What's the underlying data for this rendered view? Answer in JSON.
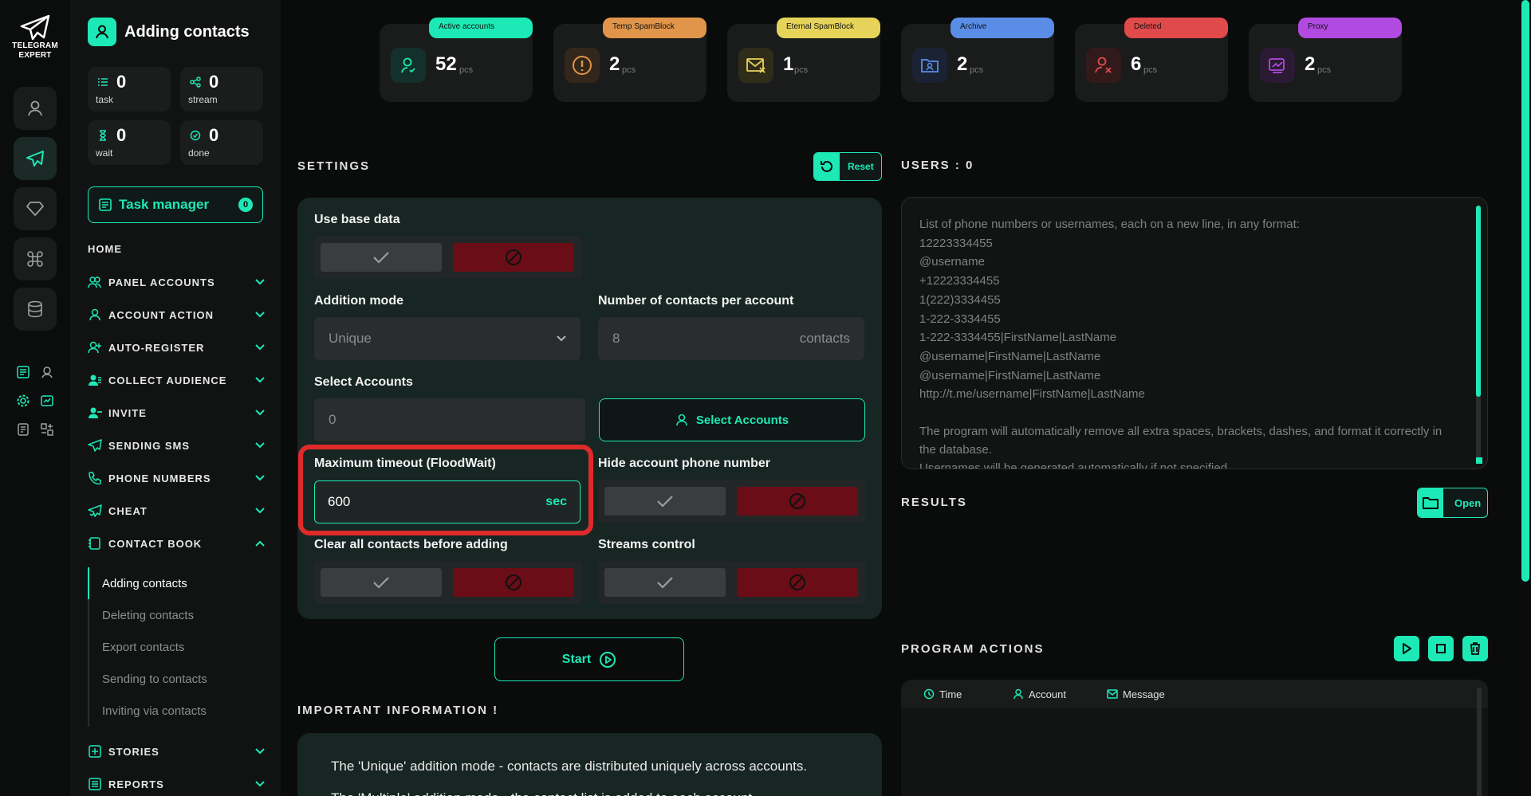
{
  "app": {
    "logo_line1": "TELEGRAM",
    "logo_line2": "EXPERT"
  },
  "sidebar": {
    "title": "Adding contacts",
    "stats": [
      {
        "value": "0",
        "label": "task"
      },
      {
        "value": "0",
        "label": "stream"
      },
      {
        "value": "0",
        "label": "wait"
      },
      {
        "value": "0",
        "label": "done"
      }
    ],
    "task_manager": {
      "label": "Task manager",
      "count": "0"
    },
    "home": "HOME",
    "nav": [
      "PANEL ACCOUNTS",
      "ACCOUNT ACTION",
      "AUTO-REGISTER",
      "COLLECT AUDIENCE",
      "INVITE",
      "SENDING SMS",
      "PHONE NUMBERS",
      "CHEAT",
      "CONTACT BOOK"
    ],
    "sub_items": [
      "Adding contacts",
      "Deleting contacts",
      "Export contacts",
      "Sending to contacts",
      "Inviting via contacts"
    ],
    "nav_bottom": [
      "STORIES",
      "REPORTS"
    ]
  },
  "counters": [
    {
      "label": "Active accounts",
      "value": "52",
      "unit": "pcs",
      "color": "#1de9b6"
    },
    {
      "label": "Temp SpamBlock",
      "value": "2",
      "unit": "pcs",
      "color": "#e0954a"
    },
    {
      "label": "Eternal SpamBlock",
      "value": "1",
      "unit": "pcs",
      "color": "#e6d35a"
    },
    {
      "label": "Archive",
      "value": "2",
      "unit": "pcs",
      "color": "#5a8de6"
    },
    {
      "label": "Deleted",
      "value": "6",
      "unit": "pcs",
      "color": "#e04a4a"
    },
    {
      "label": "Proxy",
      "value": "2",
      "unit": "pcs",
      "color": "#b14ae0"
    }
  ],
  "settings": {
    "title": "SETTINGS",
    "reset": "Reset",
    "use_base_data": "Use base data",
    "addition_mode": {
      "label": "Addition mode",
      "value": "Unique"
    },
    "contacts_per_account": {
      "label": "Number of contacts per account",
      "placeholder": "8",
      "suffix": "contacts"
    },
    "select_accounts": {
      "label": "Select Accounts",
      "value": "0",
      "button": "Select Accounts"
    },
    "timeout": {
      "label": "Maximum timeout (FloodWait)",
      "value": "600",
      "suffix": "sec"
    },
    "hide_phone": "Hide account phone number",
    "clear_contacts": "Clear all contacts before adding",
    "streams_control": "Streams control",
    "start": "Start"
  },
  "info": {
    "title": "IMPORTANT INFORMATION !",
    "lines": [
      "The 'Unique' addition mode - contacts are distributed uniquely across accounts.",
      "The 'Multiple' addition mode - the contact list is added to each account."
    ]
  },
  "users": {
    "title": "USERS : 0",
    "placeholder_lines": [
      "List of phone numbers or usernames, each on a new line, in any format:",
      "12223334455",
      "@username",
      "+12223334455",
      "1(222)3334455",
      "1-222-3334455",
      "1-222-3334455|FirstName|LastName",
      "@username|FirstName|LastName",
      "@username|FirstName|LastName",
      "http://t.me/username|FirstName|LastName"
    ],
    "placeholder_para": "The program will automatically remove all extra spaces, brackets, dashes, and format it correctly in the database.",
    "placeholder_last": "Usernames will be generated automatically if not specified"
  },
  "results": {
    "title": "RESULTS",
    "open": "Open"
  },
  "actions": {
    "title": "PROGRAM ACTIONS",
    "cols": [
      "Time",
      "Account",
      "Message"
    ]
  }
}
